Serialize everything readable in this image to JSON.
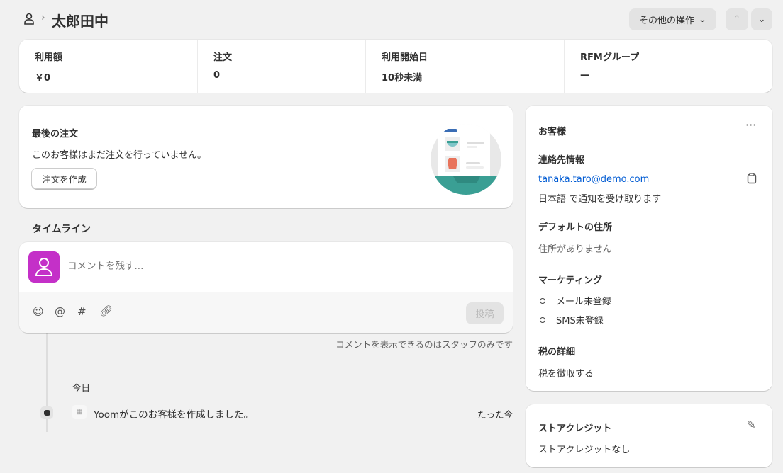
{
  "header": {
    "title": "太郎田中",
    "more_actions": "その他の操作"
  },
  "stats": [
    {
      "label": "利用額",
      "value": "￥0"
    },
    {
      "label": "注文",
      "value": "0"
    },
    {
      "label": "利用開始日",
      "value": "10秒未満"
    },
    {
      "label": "RFMグループ",
      "value": "—"
    }
  ],
  "last_order": {
    "title": "最後の注文",
    "empty": "このお客様はまだ注文を行っていません。",
    "create_button": "注文を作成"
  },
  "timeline": {
    "title": "タイムライン",
    "comment_placeholder": "コメントを残す...",
    "post_button": "投稿",
    "staff_note": "コメントを表示できるのはスタッフのみです",
    "date": "今日",
    "events": [
      {
        "text": "Yoomがこのお客様を作成しました。",
        "time": "たった今"
      }
    ]
  },
  "customer": {
    "title": "お客様",
    "contact_heading": "連絡先情報",
    "email": "tanaka.taro@demo.com",
    "notification": "日本語 で通知を受け取ります",
    "address_heading": "デフォルトの住所",
    "address": "住所がありません",
    "marketing_heading": "マーケティング",
    "marketing": [
      "メール未登録",
      "SMS未登録"
    ],
    "tax_heading": "税の詳細",
    "tax": "税を徴収する"
  },
  "store_credit": {
    "title": "ストアクレジット",
    "value": "ストアクレジットなし"
  },
  "colors": {
    "avatar": "#c430c8",
    "link": "#005bd3",
    "teal": "#3a9f94"
  }
}
